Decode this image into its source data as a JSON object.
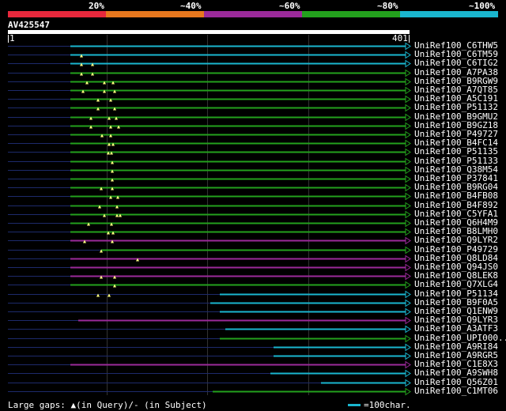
{
  "header": {
    "percent_labels": [
      "20%",
      "~40%",
      "~60%",
      "~80%",
      "~100%"
    ],
    "colors": [
      "#e8283c",
      "#e8781e",
      "#9b2a9a",
      "#23a11d",
      "#1ab6cf"
    ]
  },
  "query": {
    "id": "AV425547",
    "start": "1",
    "end": "401"
  },
  "hits": [
    {
      "label": "UniRef100_C6THW5",
      "color": "#1ab6cf"
    },
    {
      "label": "UniRef100_C6TM59",
      "color": "#1ab6cf"
    },
    {
      "label": "UniRef100_C6TIG2",
      "color": "#1ab6cf"
    },
    {
      "label": "UniRef100_A7PA38",
      "color": "#23a11d"
    },
    {
      "label": "UniRef100_B9RGW9",
      "color": "#23a11d"
    },
    {
      "label": "UniRef100_A7QT85",
      "color": "#23a11d"
    },
    {
      "label": "UniRef100_A5C191",
      "color": "#23a11d"
    },
    {
      "label": "UniRef100_P51132",
      "color": "#23a11d"
    },
    {
      "label": "UniRef100_B9GMU2",
      "color": "#23a11d"
    },
    {
      "label": "UniRef100_B9GZ18",
      "color": "#23a11d"
    },
    {
      "label": "UniRef100_P49727",
      "color": "#23a11d"
    },
    {
      "label": "UniRef100_B4FC14",
      "color": "#23a11d"
    },
    {
      "label": "UniRef100_P51135",
      "color": "#23a11d"
    },
    {
      "label": "UniRef100_P51133",
      "color": "#23a11d"
    },
    {
      "label": "UniRef100_Q38M54",
      "color": "#23a11d"
    },
    {
      "label": "UniRef100_P37841",
      "color": "#23a11d"
    },
    {
      "label": "UniRef100_B9RG04",
      "color": "#23a11d"
    },
    {
      "label": "UniRef100_B4FB08",
      "color": "#23a11d"
    },
    {
      "label": "UniRef100_B4F892",
      "color": "#23a11d"
    },
    {
      "label": "UniRef100_C5YFA1",
      "color": "#23a11d"
    },
    {
      "label": "UniRef100_Q6H4M9",
      "color": "#23a11d"
    },
    {
      "label": "UniRef100_B8LMH0",
      "color": "#23a11d"
    },
    {
      "label": "UniRef100_Q9LYR2",
      "color": "#9b2a9a"
    },
    {
      "label": "UniRef100_P49729",
      "color": "#23a11d"
    },
    {
      "label": "UniRef100_Q8LD84",
      "color": "#9b2a9a"
    },
    {
      "label": "UniRef100_Q94JS0",
      "color": "#9b2a9a"
    },
    {
      "label": "UniRef100_Q8LEK8",
      "color": "#9b2a9a"
    },
    {
      "label": "UniRef100_Q7XLG4",
      "color": "#23a11d"
    },
    {
      "label": "UniRef100_P51134",
      "color": "#1ab6cf"
    },
    {
      "label": "UniRef100_B9F0A5",
      "color": "#1ab6cf"
    },
    {
      "label": "UniRef100_Q1ENW9",
      "color": "#1ab6cf"
    },
    {
      "label": "UniRef100_Q9LYR3",
      "color": "#9b2a9a"
    },
    {
      "label": "UniRef100_A3ATF3",
      "color": "#1ab6cf"
    },
    {
      "label": "UniRef100_UPI000..",
      "color": "#23a11d"
    },
    {
      "label": "UniRef100_A9RI84",
      "color": "#1ab6cf"
    },
    {
      "label": "UniRef100_A9RGR5",
      "color": "#1ab6cf"
    },
    {
      "label": "UniRef100_C1E8X3",
      "color": "#9b2a9a"
    },
    {
      "label": "UniRef100_A9SWH8",
      "color": "#1ab6cf"
    },
    {
      "label": "UniRef100_Q56Z01",
      "color": "#1ab6cf"
    },
    {
      "label": "UniRef100_C1MT06",
      "color": "#23a11d"
    }
  ],
  "footer": {
    "gaps_text": "Large gaps: ▲(in Query)/- (in Subject)",
    "legend_text": "=100char."
  }
}
